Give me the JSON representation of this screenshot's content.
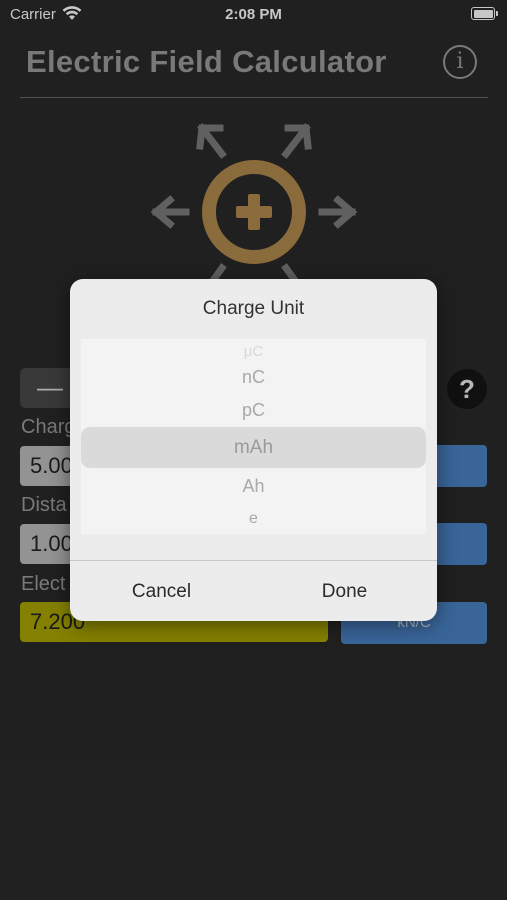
{
  "status": {
    "carrier": "Carrier",
    "time": "2:08 PM"
  },
  "header": {
    "title": "Electric Field Calculator",
    "info_icon": "i"
  },
  "controls": {
    "minus_label": "—",
    "help_label": "?",
    "charge_label": "Charg",
    "charge_value": "5.00",
    "distance_label": "Dista",
    "distance_value": "1.00",
    "field_label": "Elect",
    "field_value": "7.200",
    "field_unit": "kN/C"
  },
  "picker": {
    "title": "Charge Unit",
    "options": [
      "μC",
      "nC",
      "pC",
      "mAh",
      "Ah",
      "e"
    ],
    "selected": "mAh",
    "cancel_label": "Cancel",
    "done_label": "Done"
  },
  "colors": {
    "background": "#2a2a2a",
    "charge_ring": "#b08a4d",
    "result_field": "#aaa600",
    "unit_button": "#4a82c4"
  }
}
